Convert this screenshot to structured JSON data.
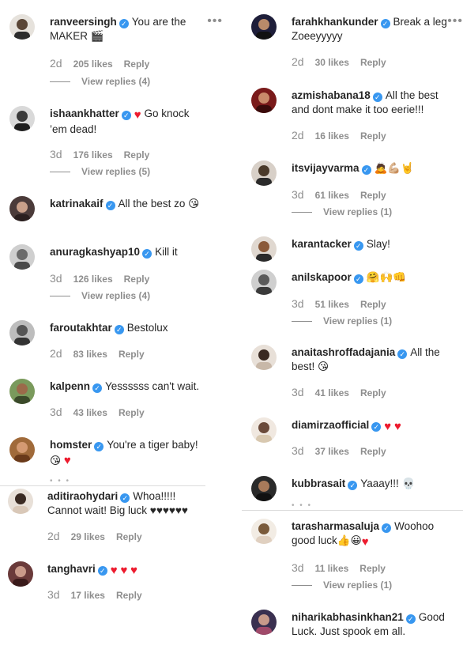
{
  "left_comments": [
    {
      "user": "ranveersingh",
      "text": "You are the MAKER 🎬",
      "time": "2d",
      "likes": "205 likes",
      "reply": "Reply",
      "replies": "View replies (4)",
      "more": "•••"
    },
    {
      "user": "ishaankhatter",
      "text": "Go knock ’em dead!",
      "time": "3d",
      "likes": "176 likes",
      "reply": "Reply",
      "replies": "View replies (5)"
    },
    {
      "user": "katrinakaif",
      "text": "All the best zo 😘"
    },
    {
      "user": "anuragkashyap10",
      "text": "Kill it",
      "time": "3d",
      "likes": "126 likes",
      "reply": "Reply",
      "replies": "View replies (4)"
    },
    {
      "user": "faroutakhtar",
      "text": "Bestolux",
      "time": "2d",
      "likes": "83 likes",
      "reply": "Reply"
    },
    {
      "user": "kalpenn",
      "text": "Yessssss can't wait.",
      "time": "3d",
      "likes": "43 likes",
      "reply": "Reply"
    },
    {
      "user": "homster",
      "text": "You're a tiger baby!"
    },
    {
      "user": "aditiraohydari",
      "text": "Whoa!!!!! Cannot wait! Big luck ♥♥♥♥♥♥",
      "time": "2d",
      "likes": "29 likes",
      "reply": "Reply"
    },
    {
      "user": "tanghavri",
      "text": "",
      "time": "3d",
      "likes": "17 likes",
      "reply": "Reply"
    }
  ],
  "right_comments": [
    {
      "user": "farahkhankunder",
      "text": "Break a leg Zoeeyyyyy",
      "time": "2d",
      "likes": "30 likes",
      "reply": "Reply",
      "more": "•••"
    },
    {
      "user": "azmishabana18",
      "text": "All the best and dont make it too eerie!!!",
      "time": "2d",
      "likes": "16 likes",
      "reply": "Reply"
    },
    {
      "user": "itsvijayvarma",
      "text": "🙇💪🏼🤘",
      "time": "3d",
      "likes": "61 likes",
      "reply": "Reply",
      "replies": "View replies (1)"
    },
    {
      "user": "karantacker",
      "text": "Slay!"
    },
    {
      "user": "anilskapoor",
      "text": "🤗🙌👊",
      "time": "3d",
      "likes": "51 likes",
      "reply": "Reply",
      "replies": "View replies (1)"
    },
    {
      "user": "anaitashroffadajania",
      "text": "All the best! 😘",
      "time": "3d",
      "likes": "41 likes",
      "reply": "Reply"
    },
    {
      "user": "diamirzaofficial",
      "text": "",
      "time": "3d",
      "likes": "37 likes",
      "reply": "Reply"
    },
    {
      "user": "kubbrasait",
      "text": "Yaaay!!! 💀"
    },
    {
      "user": "tarasharmasaluja",
      "text": "Woohoo good luck👍😀",
      "time": "3d",
      "likes": "11 likes",
      "reply": "Reply",
      "replies": "View replies (1)"
    },
    {
      "user": "niharikabhasinkhan21",
      "text": "Good Luck. Just spook em all."
    }
  ],
  "colors": {
    "verified": "#3897f0",
    "muted": "#8e8e8e",
    "heart": "#ed1b2e",
    "text": "#262626"
  },
  "icons": {
    "verified": "verified-badge-icon",
    "more": "more-options-icon",
    "heart": "red-heart-icon"
  }
}
